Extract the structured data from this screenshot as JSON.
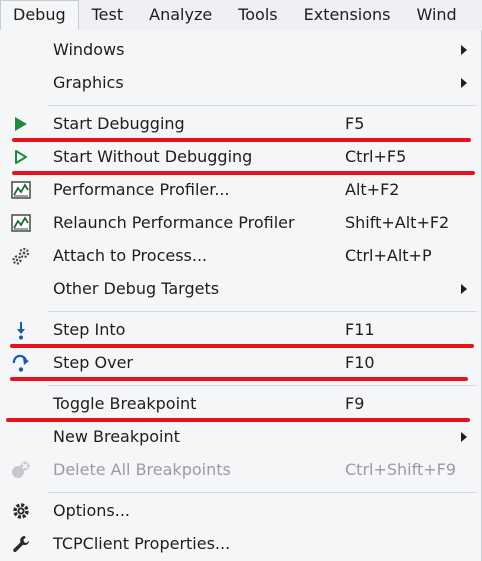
{
  "menubar": {
    "items": [
      {
        "label": "Debug",
        "active": true
      },
      {
        "label": "Test"
      },
      {
        "label": "Analyze"
      },
      {
        "label": "Tools"
      },
      {
        "label": "Extensions"
      },
      {
        "label": "Wind"
      }
    ]
  },
  "menu": {
    "windows": {
      "label": "Windows"
    },
    "graphics": {
      "label": "Graphics"
    },
    "start_debugging": {
      "label": "Start Debugging",
      "shortcut": "F5",
      "icon": "play-solid-icon"
    },
    "start_without_debugging": {
      "label": "Start Without Debugging",
      "shortcut": "Ctrl+F5",
      "icon": "play-outline-icon"
    },
    "performance_profiler": {
      "label": "Performance Profiler...",
      "shortcut": "Alt+F2",
      "icon": "profiler-chart-icon"
    },
    "relaunch_profiler": {
      "label": "Relaunch Performance Profiler",
      "shortcut": "Shift+Alt+F2",
      "icon": "profiler-chart-icon"
    },
    "attach_to_process": {
      "label": "Attach to Process...",
      "shortcut": "Ctrl+Alt+P",
      "icon": "gears-icon"
    },
    "other_debug_targets": {
      "label": "Other Debug Targets"
    },
    "step_into": {
      "label": "Step Into",
      "shortcut": "F11",
      "icon": "step-into-icon"
    },
    "step_over": {
      "label": "Step Over",
      "shortcut": "F10",
      "icon": "step-over-icon"
    },
    "toggle_breakpoint": {
      "label": "Toggle Breakpoint",
      "shortcut": "F9"
    },
    "new_breakpoint": {
      "label": "New Breakpoint"
    },
    "delete_all_breakpoints": {
      "label": "Delete All Breakpoints",
      "shortcut": "Ctrl+Shift+F9",
      "icon": "delete-breakpoints-icon",
      "disabled": true
    },
    "options": {
      "label": "Options...",
      "icon": "gear-icon"
    },
    "tcpclient_properties": {
      "label": "TCPClient Properties...",
      "icon": "wrench-icon"
    }
  },
  "colors": {
    "highlight_line": "#e6131b",
    "play_green": "#1e8a3c",
    "step_blue": "#1a5aa8",
    "menubar_bg": "#eef0f5",
    "menu_bg": "#f5f6f7"
  }
}
